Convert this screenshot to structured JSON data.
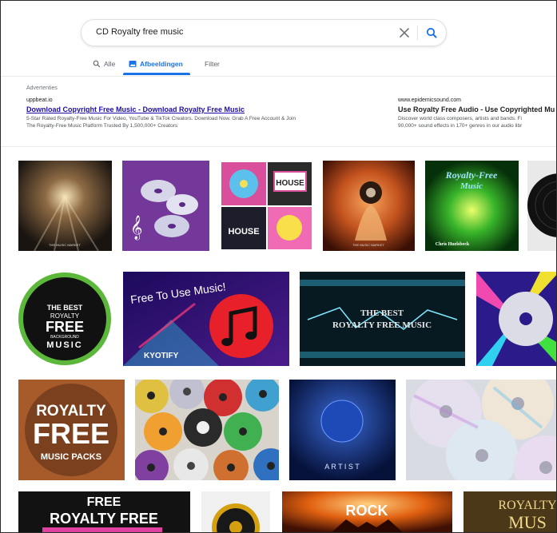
{
  "search": {
    "query": "CD Royalty free music"
  },
  "tabs": [
    {
      "label": "Alle",
      "active": false
    },
    {
      "label": "Afbeeldingen",
      "active": true
    },
    {
      "label": "Filter",
      "active": false
    }
  ],
  "ads": {
    "label": "Advertenties",
    "items": [
      {
        "domain": "uppbeat.io",
        "title": "Download Copyright Free Music - Download Royalty Free Music",
        "desc1": "5-Star Rated Royalty-Free Music For Video, YouTube & TikTok Creators. Download Now. Grab A Free Account & Join",
        "desc2": "The Royalty-Free Music Platform Trusted By 1,500,000+ Creators"
      },
      {
        "domain": "www.epidemicsound.com",
        "title": "Use Royalty Free Audio - Use Copyrighted Mu",
        "desc1": "Discover world class composers, artists and bands. Fi",
        "desc2": "90,000+ sound effects in 170+ genres in our audio libr"
      }
    ]
  },
  "thumb_text": {
    "music_market_1": "THE MUSIC MARKET",
    "music_market_2": "THE MUSIC MARKET",
    "royalty_free_top": "Royalty-Free",
    "royalty_free_bottom": "Music",
    "chris": "Chris Huelsbeck",
    "house": "HOUSE",
    "best_1": "THE BEST",
    "best_2": "ROYALTY",
    "best_3": "FREE",
    "best_4": "BACKGROUND",
    "best_5": "MUSIC",
    "free_to_use": "Free To Use Music!",
    "kyotify": "KYOTIFY",
    "best_rf_1": "THE BEST",
    "best_rf_2": "ROYALTY FREE MUSIC",
    "packs_1": "ROYALTY",
    "packs_2": "FREE",
    "packs_3": "MUSIC PACKS",
    "artist": "A R T I S T",
    "free_rf_1": "FREE",
    "free_rf_2": "ROYALTY FREE",
    "rock": "ROCK",
    "royalty_mu_1": "ROYALTY",
    "royalty_mu_2": "MUS"
  },
  "colors": {
    "accent": "#1a73e8",
    "ad_link": "#1a0dab"
  }
}
